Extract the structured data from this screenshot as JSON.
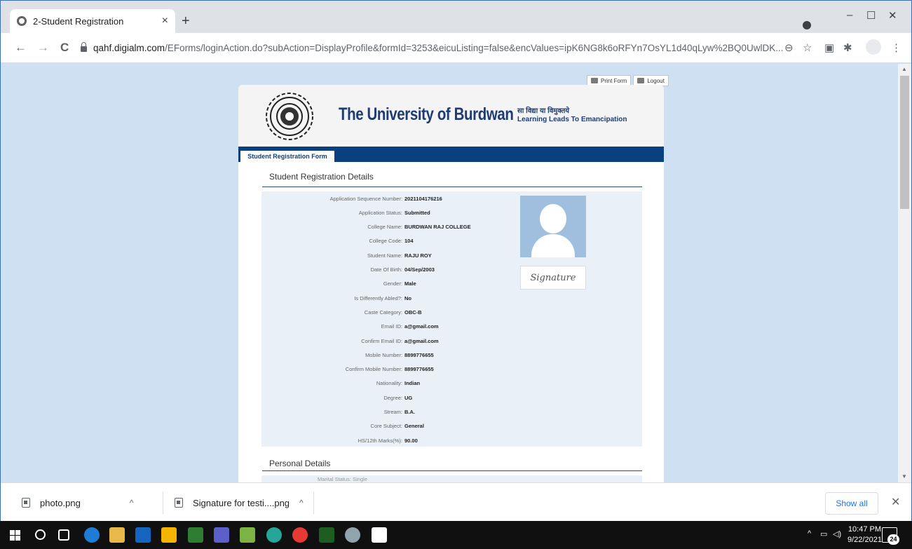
{
  "browser": {
    "tab_title": "2-Student Registration",
    "tab_close": "×",
    "new_tab": "+",
    "url_host": "qahf.digialm.com",
    "url_path": "/EForms/loginAction.do?subAction=DisplayProfile&formId=3253&eicuListing=false&encValues=ipK6NG8k6oRFYn7OsYL1d40qLyw%2BQ0UwlDK...",
    "nav": {
      "back": "←",
      "forward": "→",
      "reload": "C"
    },
    "window_controls": {
      "minimize": "–",
      "maximize": "☐",
      "close": "✕"
    },
    "toolbar_icons": [
      "zoom-icon",
      "star-icon",
      "extension-icon",
      "puzzle-icon",
      "profile-icon",
      "menu-icon"
    ]
  },
  "page_actions": {
    "print_label": "Print Form",
    "logout_label": "Logout"
  },
  "header": {
    "university_name": "The University of Burdwan",
    "motto_hindi": "सा विद्या या विमुक्तये",
    "motto_english": "Learning Leads To Emancipation"
  },
  "nav_tab": "Student Registration Form",
  "sections": {
    "registration_title": "Student Registration Details",
    "personal_title": "Personal Details"
  },
  "registration_details": [
    {
      "label": "Application Sequence Number:",
      "value": "2021104176216"
    },
    {
      "label": "Application Status:",
      "value": "Submitted"
    },
    {
      "label": "College Name:",
      "value": "BURDWAN RAJ COLLEGE"
    },
    {
      "label": "College Code:",
      "value": "104"
    },
    {
      "label": "Student Name:",
      "value": "RAJU ROY"
    },
    {
      "label": "Date Of Birth:",
      "value": "04/Sep/2003"
    },
    {
      "label": "Gender:",
      "value": "Male"
    },
    {
      "label": "Is Differently Abled?:",
      "value": "No"
    },
    {
      "label": "Caste Category:",
      "value": "OBC-B"
    },
    {
      "label": "Email ID:",
      "value": "a@gmail.com"
    },
    {
      "label": "Confirm Email ID:",
      "value": "a@gmail.com"
    },
    {
      "label": "Mobile Number:",
      "value": "8899776655"
    },
    {
      "label": "Confirm Mobile Number:",
      "value": "8899776655"
    },
    {
      "label": "Nationality:",
      "value": "Indian"
    },
    {
      "label": "Degree:",
      "value": "UG"
    },
    {
      "label": "Stream:",
      "value": "B.A."
    },
    {
      "label": "Core Subject:",
      "value": "General"
    },
    {
      "label": "HS/12th Marks(%):",
      "value": "90.00"
    }
  ],
  "signature_text": "Signature",
  "personal_partial": "Marital Status: Single",
  "downloads": {
    "items": [
      "photo.png",
      "Signature for testi....png"
    ],
    "caret": "^",
    "show_all": "Show all",
    "close": "✕"
  },
  "taskbar": {
    "time": "10:47 PM",
    "date": "9/22/2021",
    "notification_count": "24",
    "tray_caret": "^"
  }
}
